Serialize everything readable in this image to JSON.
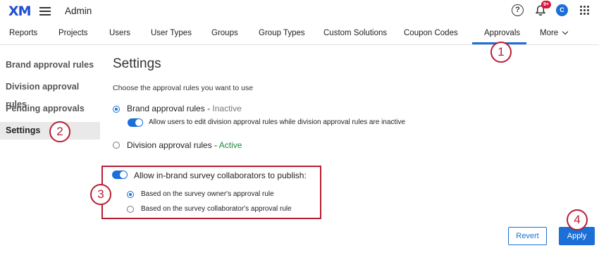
{
  "header": {
    "logo": "XM",
    "title": "Admin",
    "help_glyph": "?",
    "notification_badge": "9+",
    "avatar_initial": "C",
    "icons": [
      "hamburger-menu-icon",
      "help-icon",
      "bell-icon",
      "apps-grid-icon"
    ]
  },
  "nav": {
    "items": [
      "Reports",
      "Projects",
      "Users",
      "User Types",
      "Groups",
      "Group Types",
      "Custom Solutions",
      "Coupon Codes",
      "Approvals"
    ],
    "more_label": "More",
    "active": "Approvals"
  },
  "sidebar": {
    "items": [
      "Brand approval rules",
      "Division approval rules",
      "Pending approvals",
      "Settings"
    ],
    "active": "Settings"
  },
  "main": {
    "title": "Settings",
    "subtitle": "Choose the approval rules you want to use",
    "brand_rule": {
      "label": "Brand approval rules",
      "separator": " - ",
      "status": "Inactive",
      "selected": true
    },
    "division_edit_toggle": {
      "label": "Allow users to edit division approval rules while division approval rules are inactive",
      "on": true
    },
    "division_rule": {
      "label": "Division approval rules",
      "separator": " - ",
      "status": "Active",
      "selected": false
    },
    "collaborator_toggle": {
      "label": "Allow in-brand survey collaborators to publish:",
      "on": true
    },
    "collaborator_options": [
      {
        "label": "Based on the survey owner's approval rule",
        "selected": true
      },
      {
        "label": "Based on the survey collaborator's approval rule",
        "selected": false
      }
    ]
  },
  "buttons": {
    "revert": "Revert",
    "apply": "Apply"
  },
  "callouts": [
    "1",
    "2",
    "3",
    "4"
  ],
  "colors": {
    "accent": "#1b6fd6",
    "callout": "#b81e32",
    "active_status": "#1a8a3a"
  }
}
